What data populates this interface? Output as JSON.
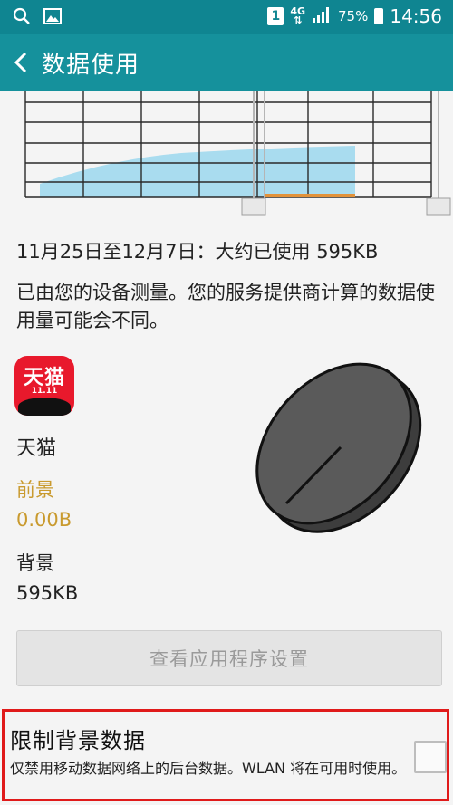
{
  "status_bar": {
    "sim_badge": "1",
    "network": "4G",
    "battery_pct": "75%",
    "time": "14:56"
  },
  "header": {
    "title": "数据使用"
  },
  "usage": {
    "period_text": "11月25日至12月7日：大约已使用 595KB",
    "note": "已由您的设备测量。您的服务提供商计算的数据使用量可能会不同。"
  },
  "app": {
    "icon_text": "天猫",
    "icon_subtext": "11.11",
    "name": "天猫",
    "foreground_label": "前景",
    "foreground_value": "0.00B",
    "background_label": "背景",
    "background_value": "595KB",
    "pie_background_fraction": 1.0
  },
  "settings_button": {
    "label": "查看应用程序设置"
  },
  "restrict": {
    "title": "限制背景数据",
    "description": "仅禁用移动数据网络上的后台数据。WLAN 将在可用时使用。",
    "checked": false
  },
  "colors": {
    "status_bar": "#0f8591",
    "action_bar": "#15919c",
    "chart_fill": "#a9dcef",
    "chart_highlight": "#e2923a",
    "foreground_text": "#c99a2e",
    "pie_fill": "#5a5a5a",
    "highlight_border": "#e01a1a"
  }
}
